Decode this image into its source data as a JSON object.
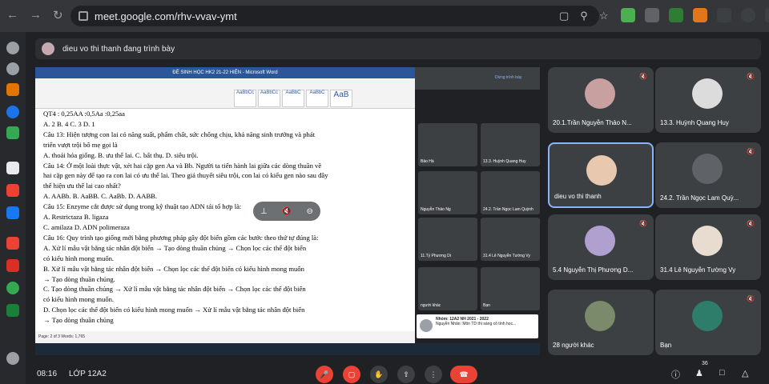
{
  "browser": {
    "url": "meet.google.com/rhv-vvav-ymt",
    "nav_icons": [
      "arrow-left-icon",
      "arrow-right-icon",
      "reload-icon"
    ]
  },
  "presenter": {
    "label": "dieu vo thi thanh đang trình bày"
  },
  "word": {
    "title": "ĐỀ SINH HỌC HK2 21-22 HIỆN - Microsoft Word",
    "status": "Page: 2 of 3   Words: 1,765",
    "doc_lines": [
      "QT4 : 0,25AA :0,5Aa :0,25aa",
      "A. 2                    B. 4                    C. 3                   D. 1",
      "Câu 13: Hiện tượng con lai có năng suất, phẩm chất, sức chống chịu, khả năng sinh trưởng và phát",
      "triển vượt trội bố mẹ gọi là",
      "    A. thoái hóa giống.        B. ưu thế lai.              C. bất thụ.                 D. siêu trội.",
      "Câu 14: Ở một loài thực vật, xét hai cặp gen Aa và Bb. Người ta tiến hành lai giữa các dòng thuần về",
      "hai cặp gen này để tạo ra con lai có ưu thế lai. Theo giả thuyết siêu trội, con lai có kiểu gen nào sau đây",
      "thể hiện ưu thế lai cao nhất?",
      "    A. AABb.              B. AaBB.              C. AaBb.              D. AABB.",
      "  Câu 15: Enzyme cắt được sử dụng trong kỹ thuật tạo ADN tái tổ hợp là:",
      "    A. Restrictaza                              B. ligaza",
      "    C. amilaza                                  D. ADN polimeraza",
      "  Câu 16: Quy trình tạo giống mới bằng phương pháp gây đột biến gồm các bước theo thứ tự đúng là:",
      "        A. Xử lí mẫu vật bằng tác nhân đột biến → Tạo dòng thuần chủng → Chọn lọc các thể đột biến",
      "có kiểu hình mong muốn.",
      "        B. Xử lí mẫu vật bằng tác nhân đột biến → Chọn lọc các thể đột biến có kiểu hình mong muốn",
      "→ Tạo dòng thuần chủng.",
      "        C. Tạo dòng thuần chủng → Xử lí mẫu vật bằng tác nhân đột biến → Chọn lọc các thể đột biến",
      "có kiểu hình mong muốn.",
      "        D. Chọn lọc các thể đột biến có kiểu hình mong muốn → Xử lí mẫu vật bằng tác nhân đột biến",
      "→ Tạo dòng thuần chủng"
    ]
  },
  "remote_view": {
    "label": "Dừng trình bày",
    "tiles": [
      {
        "name": "Bảo Hà"
      },
      {
        "name": "13.3. Huỳnh Quang Huy"
      },
      {
        "name": "Nguyễn Thảo Ng"
      },
      {
        "name": "24.2. Trần Ngọc Lam Quỳnh"
      },
      {
        "name": "11.Tỷ Phương Di"
      },
      {
        "name": "31.4 Lê Nguyễn Tường Vy"
      },
      {
        "name": "người khác"
      },
      {
        "name": "Bạn"
      }
    ]
  },
  "notification": {
    "title": "Nhóm: 12A2 NH 2021 - 2022",
    "body": "Nguyễn Nhân: Môn TD thì sáng cô tính học..."
  },
  "participants": [
    {
      "name": "20.1.Trần Nguyễn Thảo N...",
      "muted": true,
      "avatar_color": "#c9a0a0"
    },
    {
      "name": "13.3. Huỳnh Quang Huy",
      "muted": true,
      "avatar_color": "#dcdcdc"
    },
    {
      "name": "dieu vo thi thanh",
      "muted": false,
      "avatar_color": "#e8c9b0",
      "active": true
    },
    {
      "name": "24.2. Trần Ngọc Lam Quỳ...",
      "muted": true,
      "avatar_color": "#5f6368"
    },
    {
      "name": "5.4 Nguyễn Thị Phương D...",
      "muted": true,
      "avatar_color": "#b0a0d0"
    },
    {
      "name": "31.4 Lê Nguyễn Tường Vy",
      "muted": true,
      "avatar_color": "#e8dcd0"
    },
    {
      "name": "28 người khác",
      "muted": false,
      "avatar_color": "#7a8a6a"
    },
    {
      "name": "Bạn",
      "muted": true,
      "avatar_color": "#2e7d6a"
    }
  ],
  "meeting": {
    "time": "08:16",
    "code": "LỚP 12A2",
    "people_count": "36"
  },
  "colors": {
    "background": "#202124",
    "tile": "#3c4043",
    "hangup": "#ea4335",
    "accent": "#8ab4f8"
  }
}
